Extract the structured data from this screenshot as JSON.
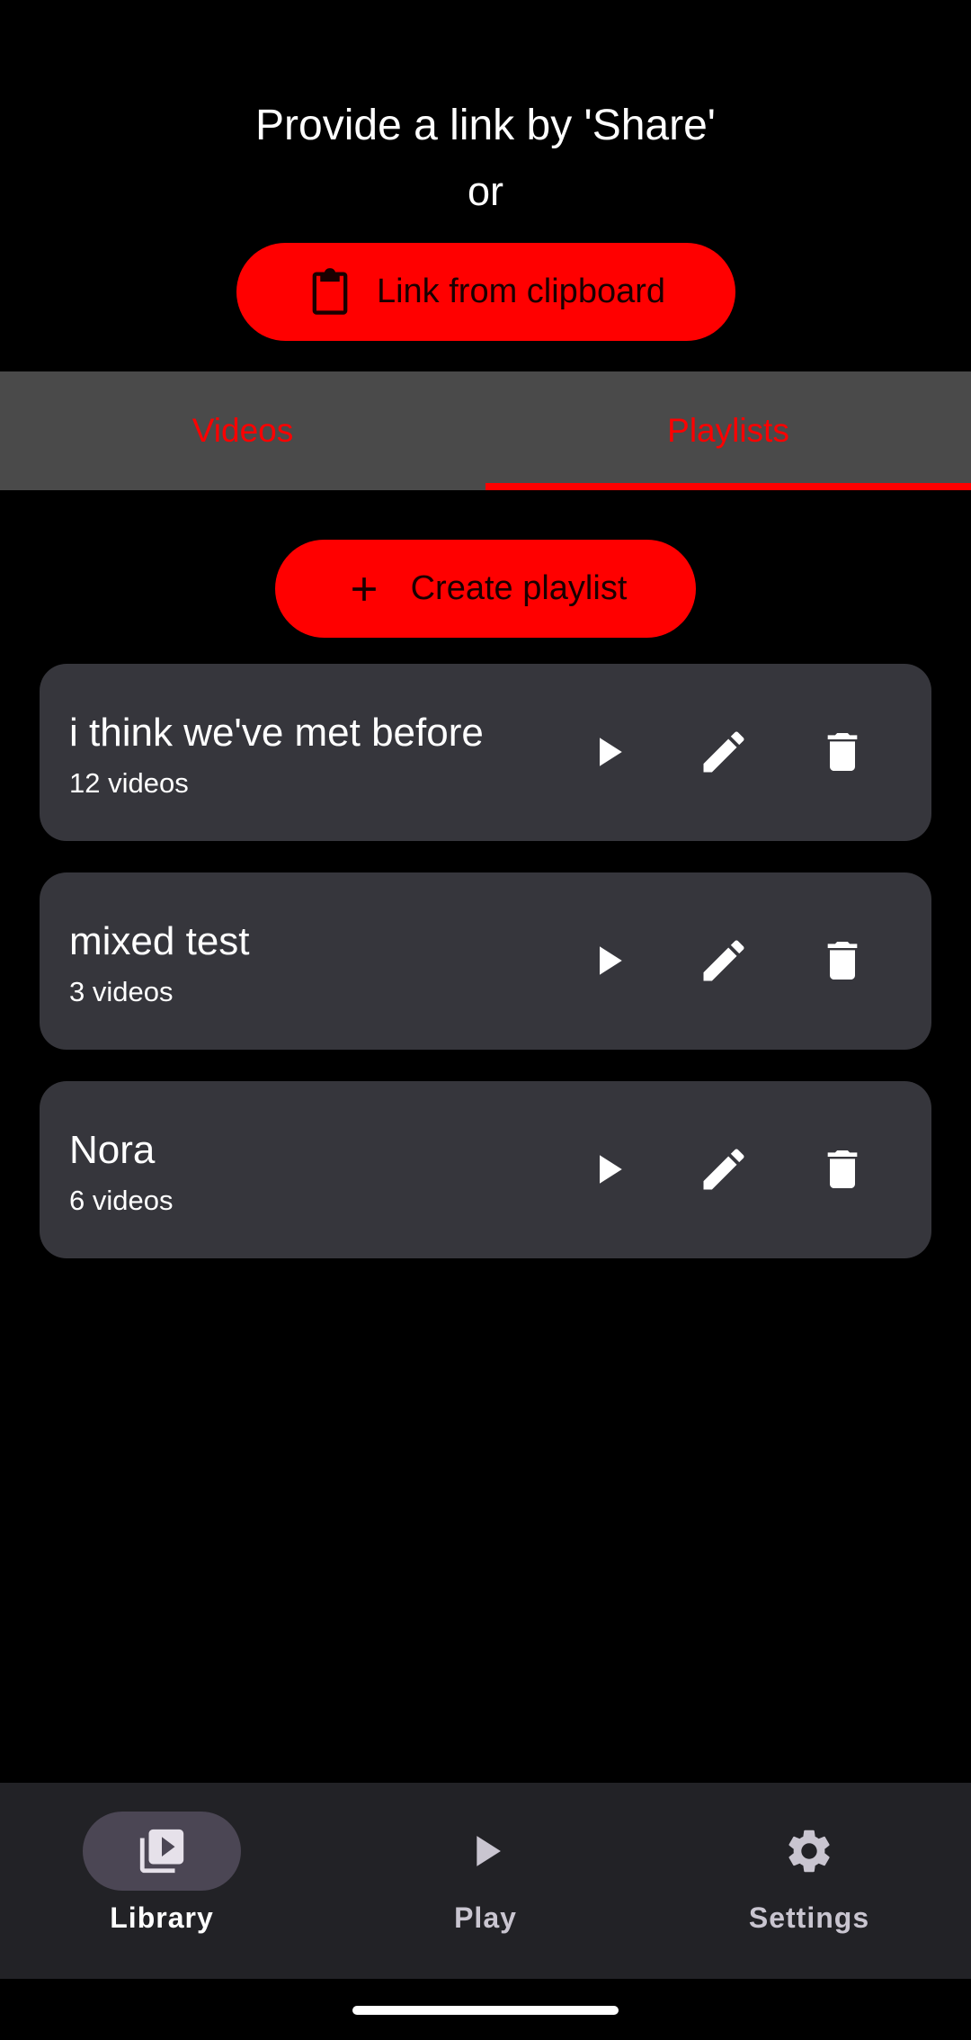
{
  "header": {
    "line1": "Provide a link by 'Share'",
    "line2": "or",
    "clipboard_button": {
      "label": "Link from clipboard",
      "icon": "clipboard-icon"
    }
  },
  "tabs": [
    {
      "label": "Videos",
      "active": false
    },
    {
      "label": "Playlists",
      "active": true
    }
  ],
  "create_button": {
    "label": "Create playlist",
    "icon": "plus-icon"
  },
  "playlists": [
    {
      "title": "i think we've met before",
      "count": "12 videos"
    },
    {
      "title": "mixed test",
      "count": "3 videos"
    },
    {
      "title": "Nora",
      "count": "6 videos"
    }
  ],
  "bottom_nav": [
    {
      "label": "Library",
      "icon": "library-icon",
      "active": true
    },
    {
      "label": "Play",
      "icon": "play-icon",
      "active": false
    },
    {
      "label": "Settings",
      "icon": "gear-icon",
      "active": false
    }
  ],
  "colors": {
    "accent": "#ff0000",
    "background": "#000000",
    "card": "#36363c",
    "tab_bar": "#4a4a4a",
    "nav_bar": "#222226"
  }
}
